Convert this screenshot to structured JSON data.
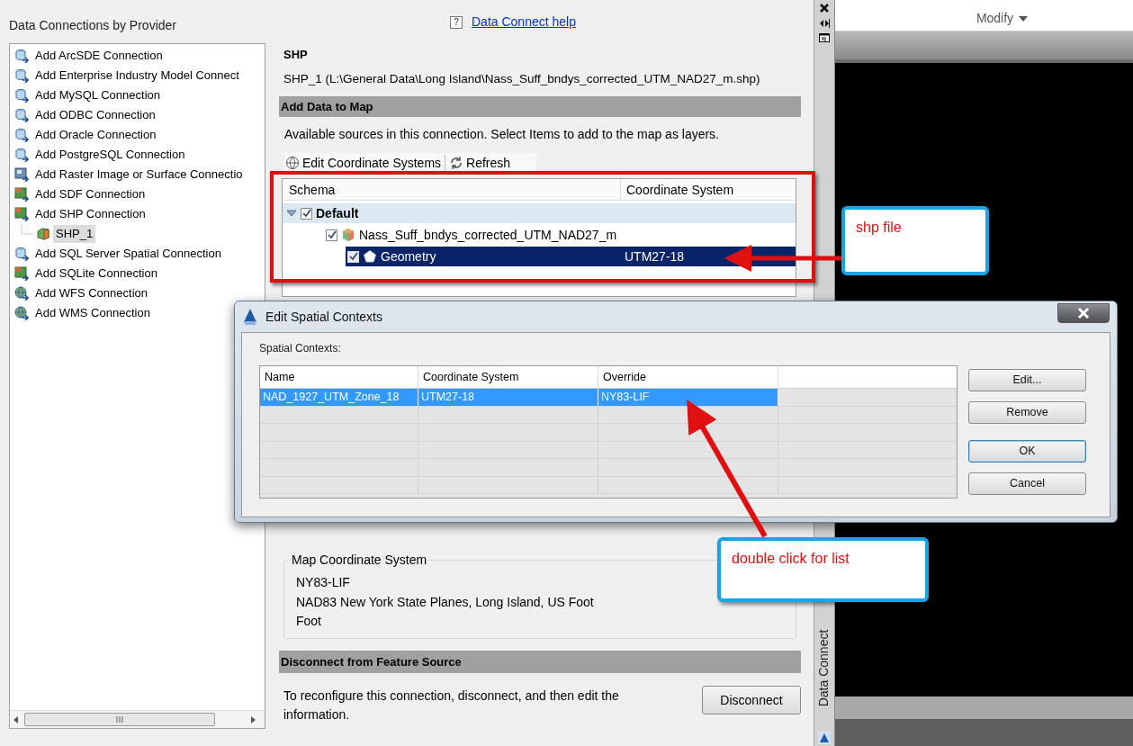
{
  "dock_panel": {
    "title": "Data Connections by Provider",
    "help_glyph": "?",
    "help_link": "Data Connect help"
  },
  "providers": [
    {
      "label": "Add ArcSDE Connection",
      "kind": "database",
      "selected": false
    },
    {
      "label": "Add Enterprise Industry Model Connect",
      "kind": "database",
      "selected": false
    },
    {
      "label": "Add MySQL Connection",
      "kind": "database",
      "selected": false
    },
    {
      "label": "Add ODBC Connection",
      "kind": "database",
      "selected": false
    },
    {
      "label": "Add Oracle Connection",
      "kind": "database",
      "selected": false
    },
    {
      "label": "Add PostgreSQL Connection",
      "kind": "database",
      "selected": false
    },
    {
      "label": "Add Raster Image or Surface Connectio",
      "kind": "raster",
      "selected": false
    },
    {
      "label": "Add SDF Connection",
      "kind": "file",
      "selected": false
    },
    {
      "label": "Add SHP Connection",
      "kind": "file",
      "selected": false,
      "children": [
        {
          "label": "SHP_1",
          "kind": "connection",
          "selected": true
        }
      ]
    },
    {
      "label": "Add SQL Server Spatial Connection",
      "kind": "database",
      "selected": false
    },
    {
      "label": "Add SQLite Connection",
      "kind": "file",
      "selected": false
    },
    {
      "label": "Add WFS Connection",
      "kind": "web",
      "selected": false
    },
    {
      "label": "Add WMS Connection",
      "kind": "web",
      "selected": false
    }
  ],
  "connection": {
    "name": "SHP",
    "source": "SHP_1 (L:\\General Data\\Long Island\\Nass_Suff_bndys_corrected_UTM_NAD27_m.shp)"
  },
  "add_data": {
    "header": "Add Data to Map",
    "instructions": "Available sources in this connection.  Select Items to add to the map as layers.",
    "toolbar": [
      {
        "label": "Edit Coordinate Systems",
        "kind": "globe"
      },
      {
        "label": "Refresh",
        "kind": "refresh"
      }
    ],
    "columns": [
      "Schema",
      "Coordinate System"
    ],
    "tree": [
      {
        "label": "Default",
        "checked": true,
        "expanded": true,
        "selected": false,
        "children": [
          {
            "label": "Nass_Suff_bndys_corrected_UTM_NAD27_m",
            "kind": "class",
            "checked": true,
            "selected": false,
            "children": [
              {
                "label": "Geometry",
                "kind": "geometry",
                "coordinate_system": "UTM27-18",
                "checked": true,
                "selected": true
              }
            ]
          }
        ]
      }
    ]
  },
  "map_coordinate_system": {
    "legend": "Map Coordinate System",
    "code": "NY83-LIF",
    "description": "NAD83 New York State Planes, Long Island, US Foot",
    "units": "Foot"
  },
  "disconnect": {
    "header": "Disconnect from Feature Source",
    "text": "To reconfigure this connection, disconnect, and then edit the information.",
    "button": "Disconnect"
  },
  "side_strip": {
    "label": "Data Connect"
  },
  "ribbon": {
    "panel_label": "Modify"
  },
  "dialog": {
    "title": "Edit Spatial Contexts",
    "group_label": "Spatial Contexts:",
    "columns": [
      "Name",
      "Coordinate System",
      "Override"
    ],
    "rows": [
      {
        "cells": [
          "NAD_1927_UTM_Zone_18",
          "UTM27-18",
          "NY83-LIF"
        ],
        "selected": true
      }
    ],
    "buttons": [
      {
        "label": "Edit...",
        "focused": false
      },
      {
        "label": "Remove",
        "focused": false
      },
      {
        "label": "OK",
        "focused": true
      },
      {
        "label": "Cancel",
        "focused": false
      }
    ]
  },
  "callouts": [
    {
      "text": "shp file"
    },
    {
      "text": "double click for list"
    }
  ]
}
